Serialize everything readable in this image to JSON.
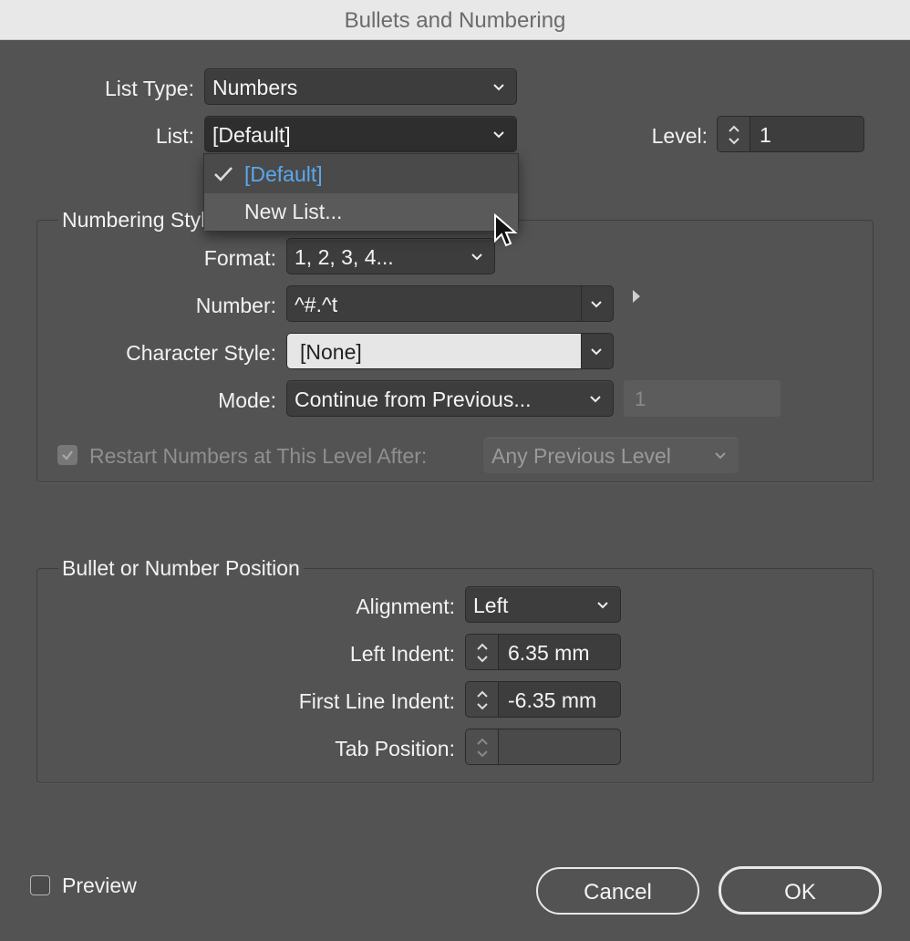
{
  "window": {
    "title": "Bullets and Numbering"
  },
  "top": {
    "list_type_label": "List Type:",
    "list_type_value": "Numbers",
    "list_label": "List:",
    "list_value": "[Default]",
    "level_label": "Level:",
    "level_value": "1"
  },
  "list_dropdown": {
    "items": [
      {
        "label": "[Default]",
        "selected": true
      },
      {
        "label": "New List...",
        "selected": false
      }
    ]
  },
  "numbering_style": {
    "title": "Numbering Style",
    "format_label": "Format:",
    "format_value": "1, 2, 3, 4...",
    "number_label": "Number:",
    "number_value": "^#.^t",
    "char_style_label": "Character Style:",
    "char_style_value": "[None]",
    "mode_label": "Mode:",
    "mode_value": "Continue from Previous...",
    "start_at_value": "1",
    "restart_label": "Restart Numbers at This Level After:",
    "restart_checked": true,
    "restart_value": "Any Previous Level"
  },
  "position": {
    "title": "Bullet or Number Position",
    "alignment_label": "Alignment:",
    "alignment_value": "Left",
    "left_indent_label": "Left Indent:",
    "left_indent_value": "6.35 mm",
    "first_line_label": "First Line Indent:",
    "first_line_value": "-6.35 mm",
    "tab_position_label": "Tab Position:",
    "tab_position_value": ""
  },
  "footer": {
    "preview_label": "Preview",
    "preview_checked": false,
    "cancel_label": "Cancel",
    "ok_label": "OK"
  },
  "colors": {
    "dialog_bg": "#535353",
    "selected_item": "#5aa8ee"
  }
}
